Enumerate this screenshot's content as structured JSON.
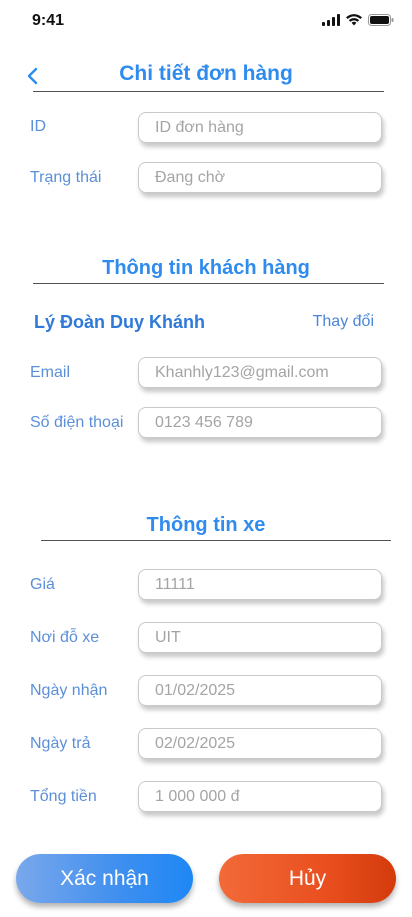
{
  "status_bar": {
    "time": "9:41"
  },
  "header": {
    "title": "Chi tiết đơn hàng"
  },
  "order": {
    "id": {
      "label": "ID",
      "placeholder": "ID đơn hàng",
      "value": ""
    },
    "status": {
      "label": "Trạng thái",
      "placeholder": "Đang chờ",
      "value": ""
    }
  },
  "customer": {
    "section_title": "Thông tin khách hàng",
    "name": "Lý Đoàn Duy Khánh",
    "change_label": "Thay đổi",
    "email": {
      "label": "Email",
      "placeholder": "Khanhly123@gmail.com",
      "value": ""
    },
    "phone": {
      "label": "Số điện thoại",
      "placeholder": "0123 456 789",
      "value": ""
    }
  },
  "vehicle": {
    "section_title": "Thông tin xe",
    "price": {
      "label": "Giá",
      "placeholder": "11111",
      "value": ""
    },
    "parking": {
      "label": "Nơi đỗ xe",
      "placeholder": "UIT",
      "value": ""
    },
    "pickup_date": {
      "label": "Ngày nhận",
      "placeholder": "01/02/2025",
      "value": ""
    },
    "return_date": {
      "label": "Ngày trả",
      "placeholder": "02/02/2025",
      "value": ""
    },
    "total": {
      "label": "Tổng tiền",
      "placeholder": "1 000 000 đ",
      "value": ""
    }
  },
  "actions": {
    "confirm_label": "Xác nhận",
    "cancel_label": "Hủy"
  },
  "colors": {
    "accent": "#2f8cee",
    "label": "#5b8fd8",
    "confirm": "#1e88f5",
    "cancel": "#e94f1f"
  }
}
